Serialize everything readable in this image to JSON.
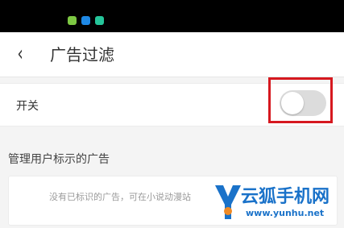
{
  "status_bar": {
    "icons": [
      "notification-green-icon",
      "play-blue-icon",
      "message-teal-icon"
    ],
    "icon_colors": [
      "#7dc843",
      "#1e88e5",
      "#25c59a"
    ]
  },
  "header": {
    "back_glyph": "‹",
    "title": "广告过滤"
  },
  "switch_row": {
    "label": "开关",
    "enabled": false
  },
  "section": {
    "title": "管理用户标示的广告",
    "empty_text": "没有已标识的广告，可在小说动漫站"
  },
  "watermark": {
    "title": "云狐手机网",
    "url": "www.yunhu.net"
  },
  "colors": {
    "highlight": "#d6181f",
    "toggle_off": "#dcdcdc",
    "watermark": "#1a72c9"
  }
}
